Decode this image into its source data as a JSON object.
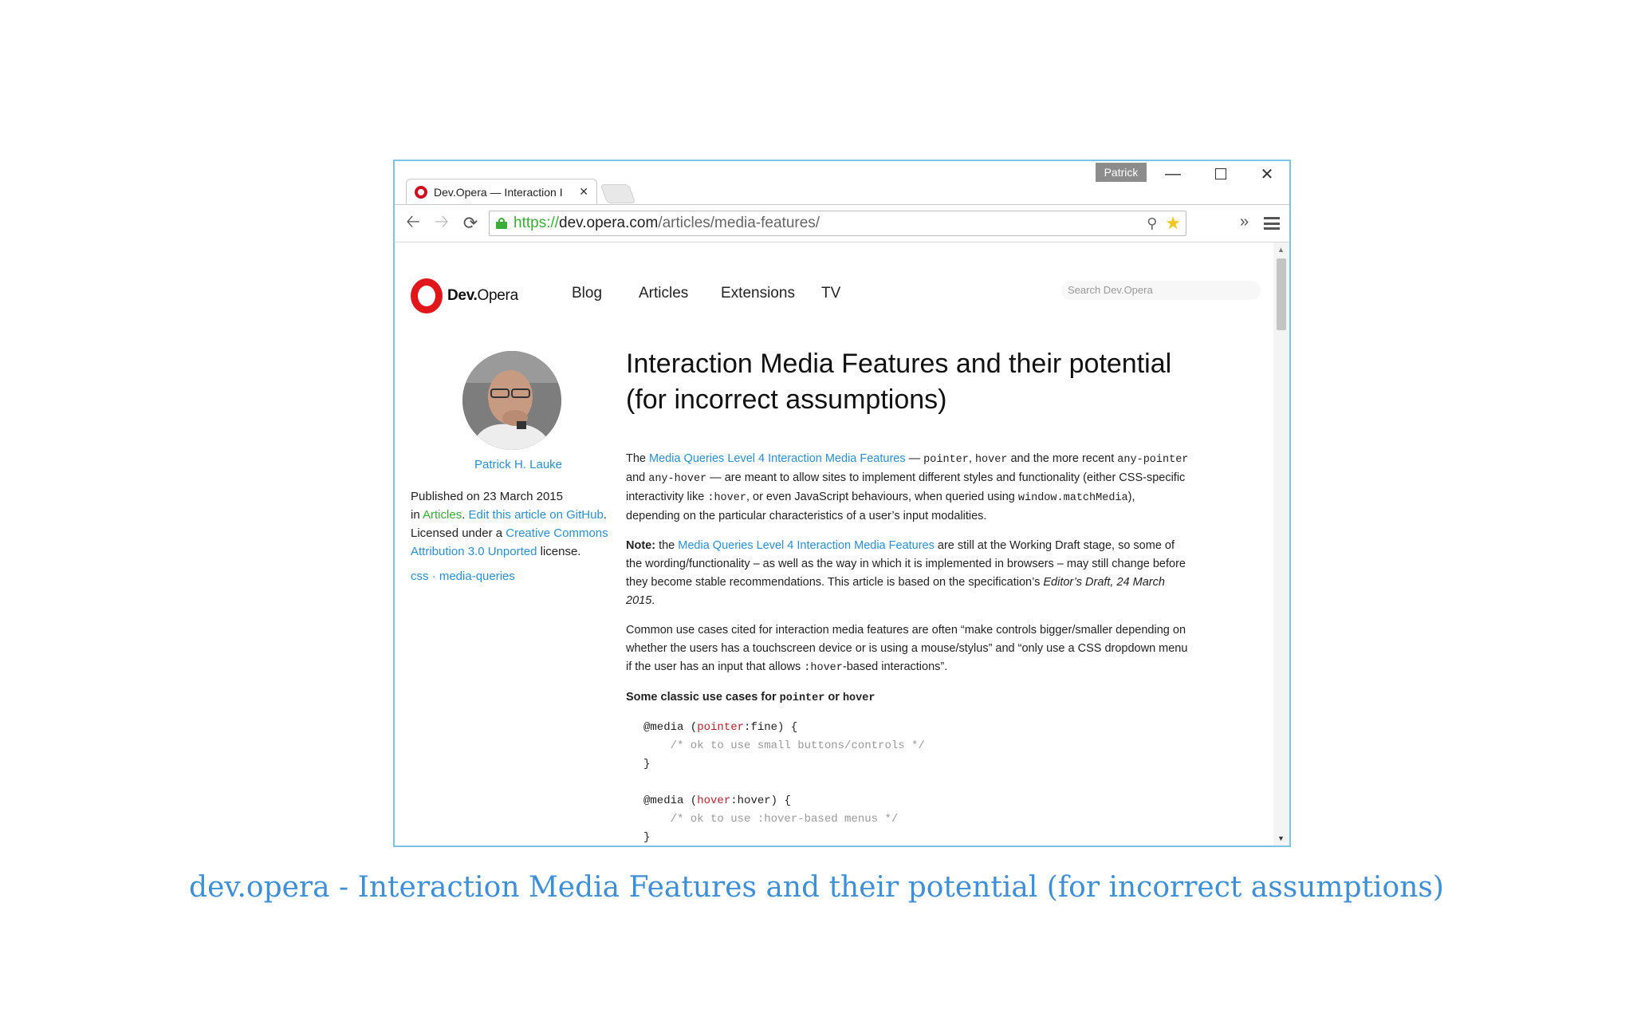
{
  "browser": {
    "profile_name": "Patrick",
    "tab_title": "Dev.Opera — Interaction I",
    "url_scheme": "https://",
    "url_host": "dev.opera.com",
    "url_path": "/articles/media-features/",
    "overflow_label": "»"
  },
  "site": {
    "logo_bold": "Dev.",
    "logo_rest": "Opera",
    "nav": [
      "Blog",
      "Articles",
      "Extensions",
      "TV"
    ],
    "search_placeholder": "Search Dev.Opera"
  },
  "sidebar": {
    "author": "Patrick H. Lauke",
    "published": "Published on 23 March 2015",
    "in_prefix": "in ",
    "in_category": "Articles",
    "edit_link": "Edit this article on GitHub",
    "license_prefix": "Licensed under a ",
    "license_link": "Creative Commons Attribution 3.0 Unported",
    "license_suffix": " license.",
    "tag1": "css",
    "tag_sep": " · ",
    "tag2": "media-queries"
  },
  "article": {
    "title_line1": "Interaction Media Features and their potential",
    "title_line2": "(for incorrect assumptions)",
    "p1": {
      "t1": "The ",
      "link": "Media Queries Level 4 Interaction Media Features",
      "t2": " — ",
      "c1": "pointer",
      "t3": ", ",
      "c2": "hover",
      "t4": " and the more recent ",
      "c3": "any-pointer",
      "t5": " and ",
      "c4": "any-hover",
      "t6": " — are meant to allow sites to implement different styles and functionality (either CSS-specific interactivity like ",
      "c5": ":hover",
      "t7": ", or even JavaScript behaviours, when queried using ",
      "c6": "window.matchMedia",
      "t8": "), depending on the particular characteristics of a user’s input modalities."
    },
    "p2": {
      "bold": "Note:",
      "t1": " the ",
      "link": "Media Queries Level 4 Interaction Media Features",
      "t2": " are still at the Working Draft stage, so some of the wording/functionality – as well as the way in which it is implemented in browsers – may still change before they become stable recommendations. This article is based on the specification’s ",
      "em": "Editor’s Draft, 24 March 2015",
      "t3": "."
    },
    "p3": {
      "t1": "Common use cases cited for interaction media features are often “make controls bigger/smaller depending on whether the users has a touchscreen device or is using a mouse/stylus” and “only use a CSS dropdown menu if the user has an input that allows ",
      "c1": ":hover",
      "t2": "-based interactions”."
    },
    "h3": {
      "t1": "Some classic use cases for ",
      "c1": "pointer",
      "t2": " or ",
      "c2": "hover"
    },
    "code": {
      "l1a": "@media (",
      "l1b": "pointer",
      "l1c": ":fine) {",
      "l2": "    /* ok to use small buttons/controls */",
      "l3": "}",
      "l4a": "@media (",
      "l4b": "hover",
      "l4c": ":hover) {",
      "l5": "    /* ok to use :hover-based menus */",
      "l6": "}"
    }
  },
  "caption": "dev.opera - Interaction Media Features and their potential (for incorrect assumptions)",
  "colors": {
    "link": "#2a8fd0",
    "caption": "#3e8fd6",
    "window_border": "#7cc3e6",
    "opera_red": "#e0161b"
  }
}
